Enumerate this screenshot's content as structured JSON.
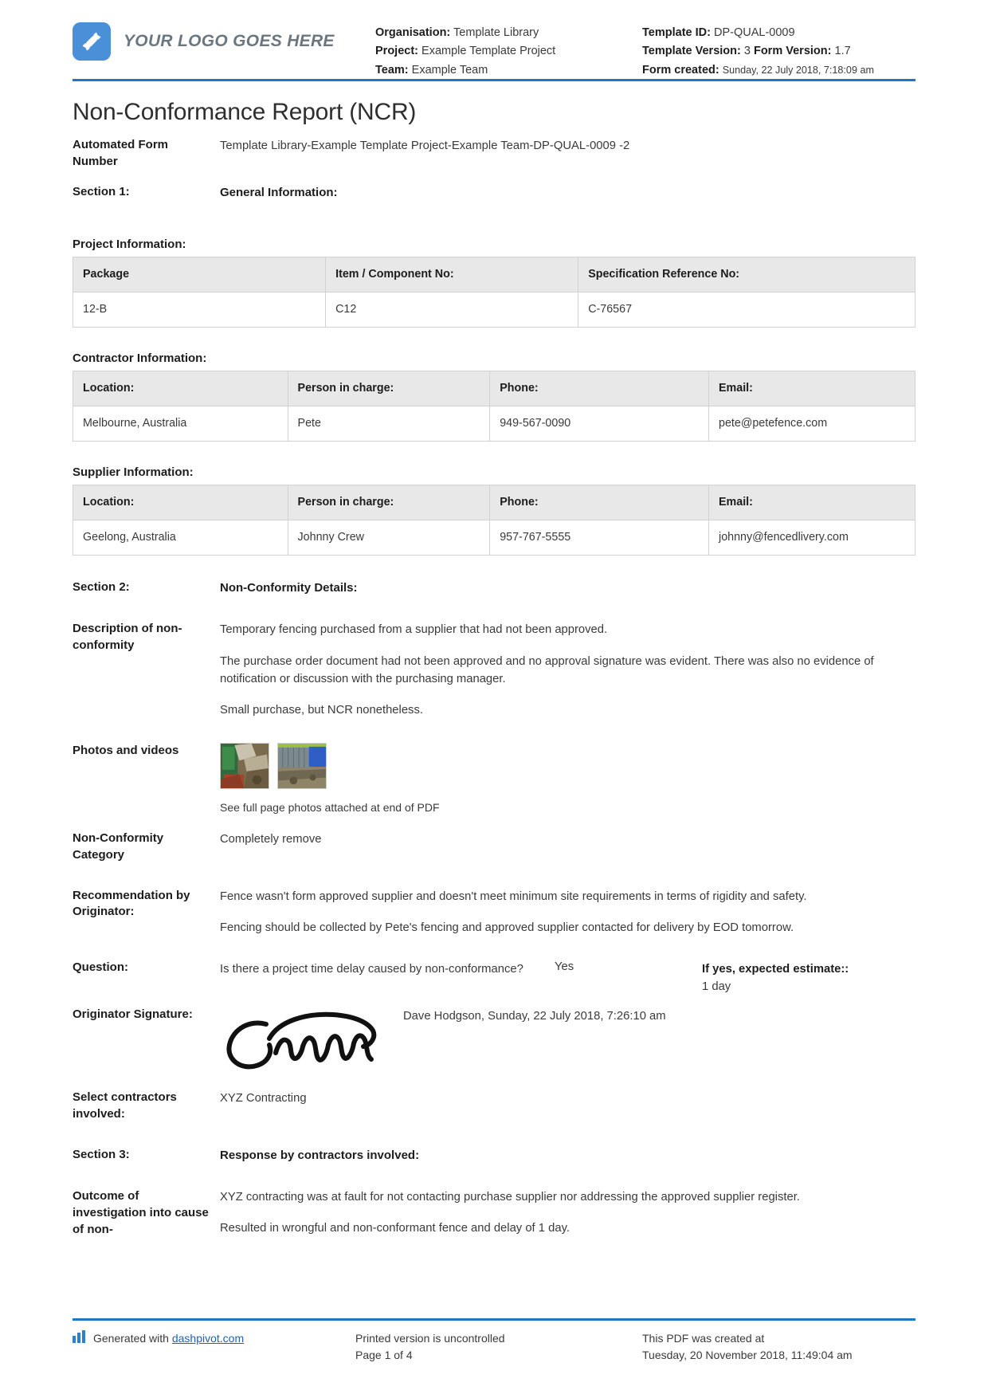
{
  "brand": {
    "accent_blue": "#1f77c4",
    "logo_blue": "#4a90d9",
    "logo_text": "YOUR LOGO GOES HERE",
    "logo_icon": "dashpivot-s-logo-icon"
  },
  "header": {
    "left": {
      "organisation_label": "Organisation:",
      "organisation_value": "Template Library",
      "project_label": "Project:",
      "project_value": "Example Template Project",
      "team_label": "Team:",
      "team_value": "Example Team"
    },
    "right": {
      "template_id_label": "Template ID:",
      "template_id_value": "DP-QUAL-0009",
      "template_version_label": "Template Version:",
      "template_version_value": "3",
      "form_version_label": "Form Version:",
      "form_version_value": "1.7",
      "form_created_label": "Form created:",
      "form_created_value": "Sunday, 22 July 2018, 7:18:09 am"
    }
  },
  "title": "Non-Conformance Report (NCR)",
  "automated_form_number": {
    "label": "Automated Form Number",
    "value": "Template Library-Example Template Project-Example Team-DP-QUAL-0009   -2"
  },
  "section1": {
    "label": "Section 1:",
    "title": "General Information:",
    "project_information": {
      "heading": "Project Information:",
      "columns": [
        "Package",
        "Item / Component No:",
        "Specification Reference No:"
      ],
      "rows": [
        [
          "12-B",
          "C12",
          "C-76567"
        ]
      ]
    },
    "contractor_information": {
      "heading": "Contractor Information:",
      "columns": [
        "Location:",
        "Person in charge:",
        "Phone:",
        "Email:"
      ],
      "rows": [
        [
          "Melbourne, Australia",
          "Pete",
          "949-567-0090",
          "pete@petefence.com"
        ]
      ]
    },
    "supplier_information": {
      "heading": "Supplier Information:",
      "columns": [
        "Location:",
        "Person in charge:",
        "Phone:",
        "Email:"
      ],
      "rows": [
        [
          "Geelong, Australia",
          "Johnny Crew",
          "957-767-5555",
          "johnny@fencedlivery.com"
        ]
      ]
    }
  },
  "section2": {
    "label": "Section 2:",
    "title": "Non-Conformity Details:",
    "description": {
      "label": "Description of non-conformity",
      "paragraphs": [
        "Temporary fencing purchased from a supplier that had not been approved.",
        "The purchase order document had not been approved and no approval signature was evident. There was also no evidence of notification or discussion with the purchasing manager.",
        "Small purchase, but NCR nonetheless."
      ]
    },
    "photos": {
      "label": "Photos and videos",
      "caption": "See full page photos attached at end of PDF",
      "thumbnails": [
        "photo-thumbnail-fence-debris",
        "photo-thumbnail-fence-blue-panel"
      ]
    },
    "category": {
      "label": "Non-Conformity Category",
      "value": "Completely remove"
    },
    "recommendation": {
      "label": "Recommendation by Originator:",
      "paragraphs": [
        "Fence wasn't form approved supplier and doesn't meet minimum site requirements in terms of rigidity and safety.",
        "Fencing should be collected by Pete's fencing and approved supplier contacted for delivery by EOD tomorrow."
      ]
    },
    "question": {
      "label": "Question:",
      "text": "Is there a project time delay caused by non-conformance?",
      "answer": "Yes",
      "estimate_label": "If yes, expected estimate::",
      "estimate_value": "1 day"
    },
    "signature": {
      "label": "Originator Signature:",
      "image_name": "originator-signature-image",
      "meta": "Dave Hodgson, Sunday, 22 July 2018, 7:26:10 am"
    },
    "contractors": {
      "label": "Select contractors involved:",
      "value": "XYZ Contracting"
    }
  },
  "section3": {
    "label": "Section 3:",
    "title": "Response by contractors involved:",
    "outcome": {
      "label": "Outcome of investigation into cause of non-",
      "paragraphs": [
        "XYZ contracting was at fault for not contacting purchase supplier nor addressing the approved supplier register.",
        "Resulted in wrongful and non-conformant fence and delay of 1 day."
      ]
    }
  },
  "footer": {
    "generated_prefix": "Generated with",
    "generated_link": "dashpivot.com",
    "printed_notice": "Printed version is uncontrolled",
    "page_number": "Page 1 of 4",
    "created_label": "This PDF was created at",
    "created_value": "Tuesday, 20 November 2018, 11:49:04 am"
  }
}
